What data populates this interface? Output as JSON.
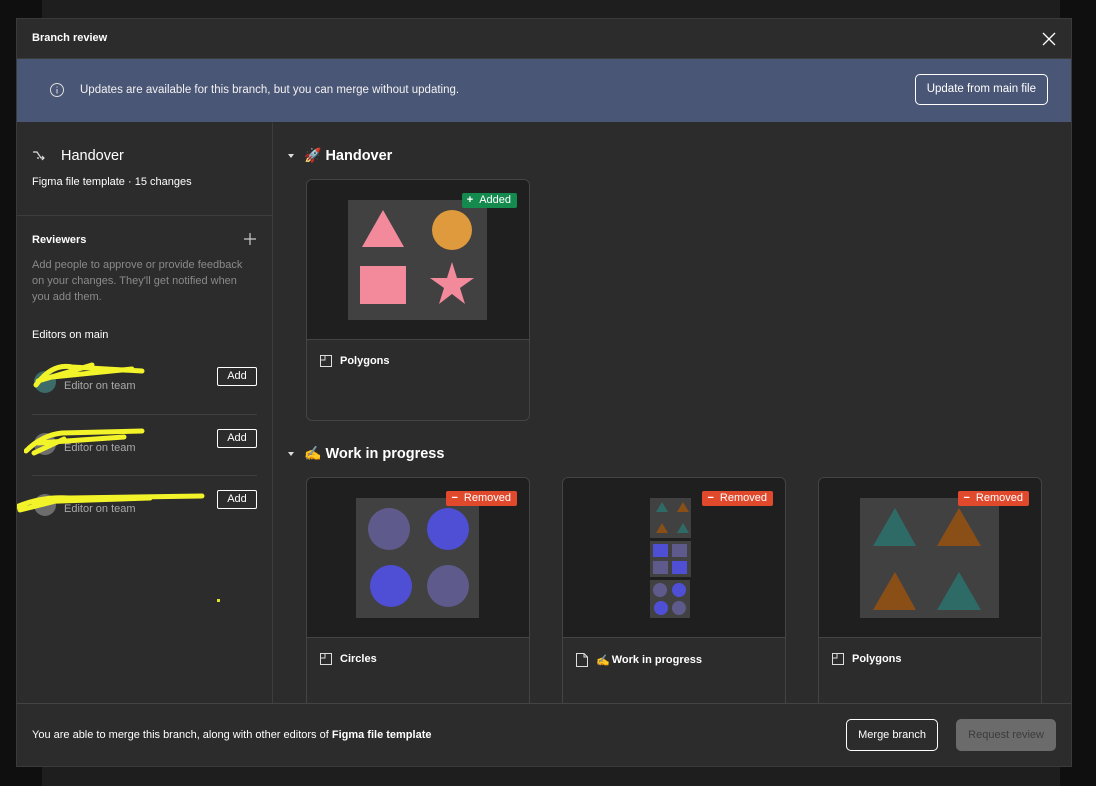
{
  "dialog": {
    "title": "Branch review",
    "close_icon": "close-icon"
  },
  "banner": {
    "icon": "info-icon",
    "message": "Updates are available for this branch, but you can merge without updating.",
    "button_label": "Update from main file"
  },
  "sidebar": {
    "branch": {
      "icon": "branch-icon",
      "name": "Handover",
      "subtitle": "Figma file template · 15 changes"
    },
    "reviewers": {
      "heading": "Reviewers",
      "add_icon": "plus-icon",
      "description": "Add people to approve or provide feedback on your changes. They'll get notified when you add them."
    },
    "editors": {
      "heading": "Editors on main",
      "items": [
        {
          "name": "[redacted]",
          "role": "Editor on team",
          "button_label": "Add"
        },
        {
          "name": "[redacted]",
          "role": "Editor on team",
          "button_label": "Add"
        },
        {
          "name": "[redacted]",
          "role": "Editor on team",
          "button_label": "Add"
        }
      ]
    }
  },
  "main": {
    "sections": [
      {
        "emoji": "🚀",
        "title": "Handover",
        "cards": [
          {
            "title": "Polygons",
            "page_icon": "frame-icon",
            "badge": {
              "type": "added",
              "symbol": "+",
              "label": "Added",
              "color": "#148a4f"
            }
          }
        ]
      },
      {
        "emoji": "✍️",
        "title": "Work in progress",
        "cards": [
          {
            "title": "Circles",
            "page_icon": "frame-icon",
            "badge": {
              "type": "removed",
              "symbol": "−",
              "label": "Removed",
              "color": "#e0492c"
            }
          },
          {
            "title_emoji": "✍️",
            "title": "Work in progress",
            "page_icon": "page-icon",
            "badge": {
              "type": "removed",
              "symbol": "−",
              "label": "Removed",
              "color": "#e0492c"
            }
          },
          {
            "title": "Polygons",
            "page_icon": "frame-icon",
            "badge": {
              "type": "removed",
              "symbol": "−",
              "label": "Removed",
              "color": "#e0492c"
            }
          }
        ]
      }
    ]
  },
  "footer": {
    "message_prefix": "You are able to merge this branch, along with other editors of ",
    "message_file": "Figma file template",
    "merge_label": "Merge branch",
    "request_label": "Request review"
  },
  "colors": {
    "banner": "#4a5676",
    "added": "#148a4f",
    "removed": "#e0492c",
    "pink": "#f28a9c",
    "orange": "#de9a3c",
    "indigo": "#4f4fd6",
    "slate": "#5e5b8c",
    "teal": "#2f6b66",
    "brown": "#8a4e17"
  }
}
